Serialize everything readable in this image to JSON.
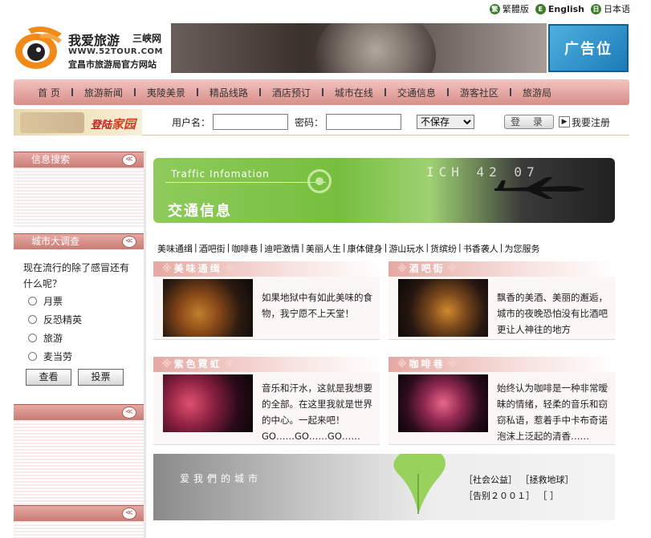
{
  "lang_bar": [
    {
      "label": "繁體版",
      "badge": "繁"
    },
    {
      "label": "English",
      "badge": "E"
    },
    {
      "label": "日本语",
      "badge": "日"
    }
  ],
  "logo": {
    "name": "我爱旅游",
    "city": "三峡网",
    "url": "WWW.52TOUR.COM",
    "subtitle": "宜昌市旅游局官方网站"
  },
  "ad": {
    "label": "广告位"
  },
  "nav": [
    "首 页",
    "旅游新闻",
    "夷陵美景",
    "精品线路",
    "酒店预订",
    "城市在线",
    "交通信息",
    "游客社区",
    "旅游局"
  ],
  "login": {
    "logo_text_1": "登陆",
    "logo_text_2": "家园",
    "username_label": "用户名：",
    "password_label": "密码：",
    "remember_value": "不保存",
    "login_button": "登 录",
    "register_link": "我要注册"
  },
  "sidebar": {
    "search_title": "信息搜索",
    "survey_title": "城市大调查",
    "poll_question": "现在流行的除了感冒还有什么呢？",
    "poll_options": [
      "月票",
      "反恐精英",
      "旅游",
      "麦当劳"
    ],
    "view_button": "查看",
    "vote_button": "投票"
  },
  "hero": {
    "title_en": "Traffic Infomation",
    "title_cn": "交通信息",
    "digits": "ICH 42 07"
  },
  "sublinks": [
    "美味通缉",
    "酒吧街",
    "咖啡巷",
    "迪吧激情",
    "美丽人生",
    "康体健身",
    "游山玩水",
    "货缤纷",
    "书香袭人",
    "为您服务"
  ],
  "cards": [
    {
      "title": "美味通缉",
      "desc": "如果地狱中有如此美味的食物，我宁愿不上天堂！",
      "pic": "food-photo"
    },
    {
      "title": "酒吧街",
      "desc": "飘香的美酒、美丽的邂逅，城市的夜晚恐怕没有比酒吧更让人神往的地方",
      "pic": "bar-photo"
    },
    {
      "title": "紫色霓虹",
      "desc": "音乐和汗水，这就是我想要的全部。在这里我就是世界的中心。一起来吧！GO……GO……GO……",
      "pic": "concert-photo"
    },
    {
      "title": "咖啡巷",
      "desc": "始终认为咖啡是一种非常暧昧的情绪，轻柔的音乐和窃窃私语，惹着手中卡布奇诺泡沫上泛起的清香……",
      "pic": "cafe-photo"
    }
  ],
  "footer": {
    "slogan": "爱我們的城市",
    "links": [
      "［社会公益］",
      "［拯救地球］",
      "［告别２００１］",
      "［ ］"
    ]
  },
  "colors": {
    "nav_pink": "#d98d88",
    "sidebar_head": "#c97c75",
    "hero_green": "#76bf3e",
    "ad_blue": "#1c7bb8"
  }
}
